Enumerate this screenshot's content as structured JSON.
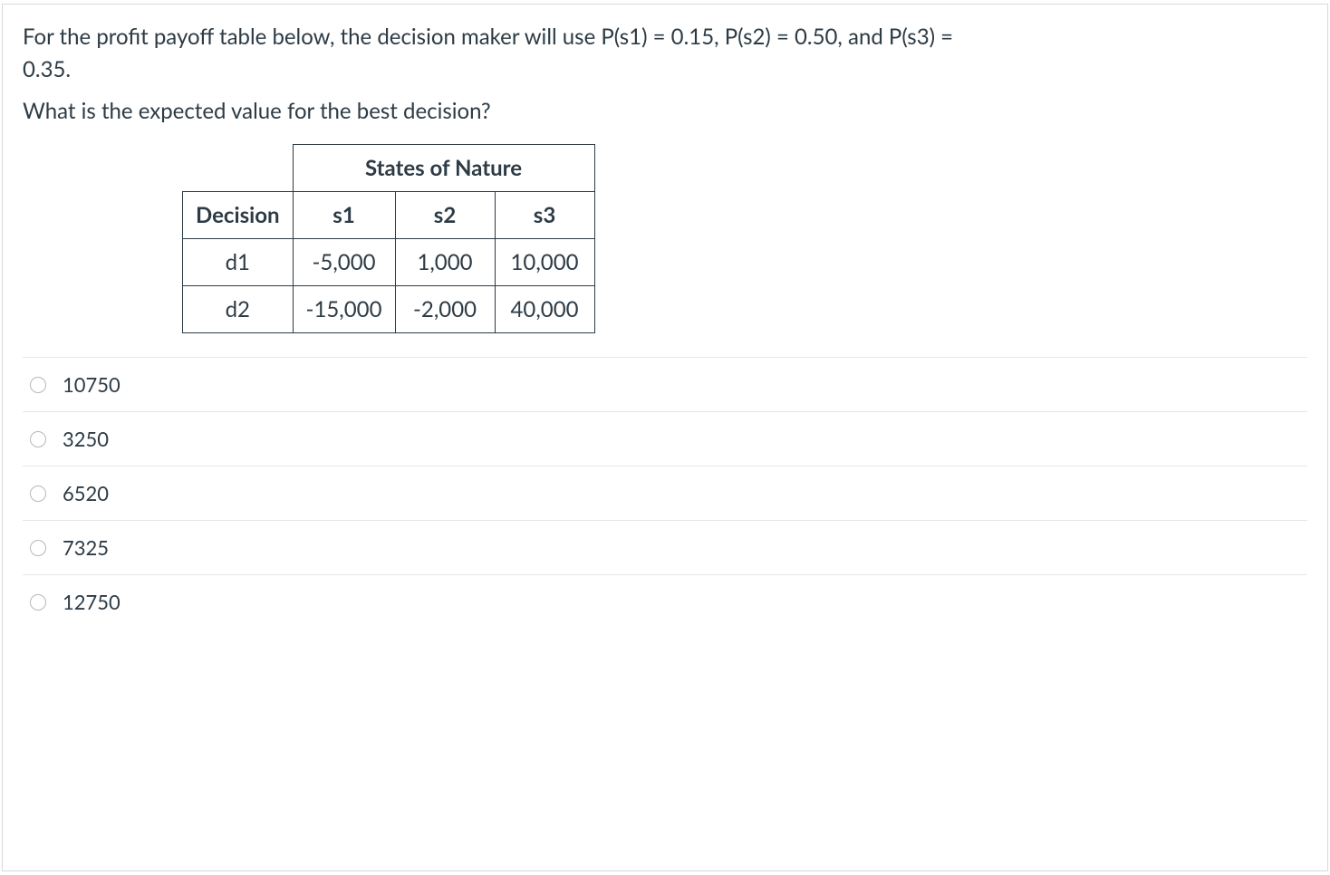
{
  "stem": {
    "line1_a": "For the profit payoff table below, the decision maker will use P(s1) = 0.15, P(s2) = 0.50, and P(s3) =",
    "line1_b": "0.35.",
    "line2": "What is the expected value for the best decision?"
  },
  "table": {
    "header_spanned": "States of Nature",
    "header_decision": "Decision",
    "cols": {
      "s1": "s1",
      "s2": "s2",
      "s3": "s3"
    },
    "rows": [
      {
        "decision": "d1",
        "s1": "-5,000",
        "s2": "1,000",
        "s3": "10,000"
      },
      {
        "decision": "d2",
        "s1": "-15,000",
        "s2": "-2,000",
        "s3": "40,000"
      }
    ]
  },
  "options": [
    {
      "label": "10750"
    },
    {
      "label": "3250"
    },
    {
      "label": "6520"
    },
    {
      "label": "7325"
    },
    {
      "label": "12750"
    }
  ]
}
